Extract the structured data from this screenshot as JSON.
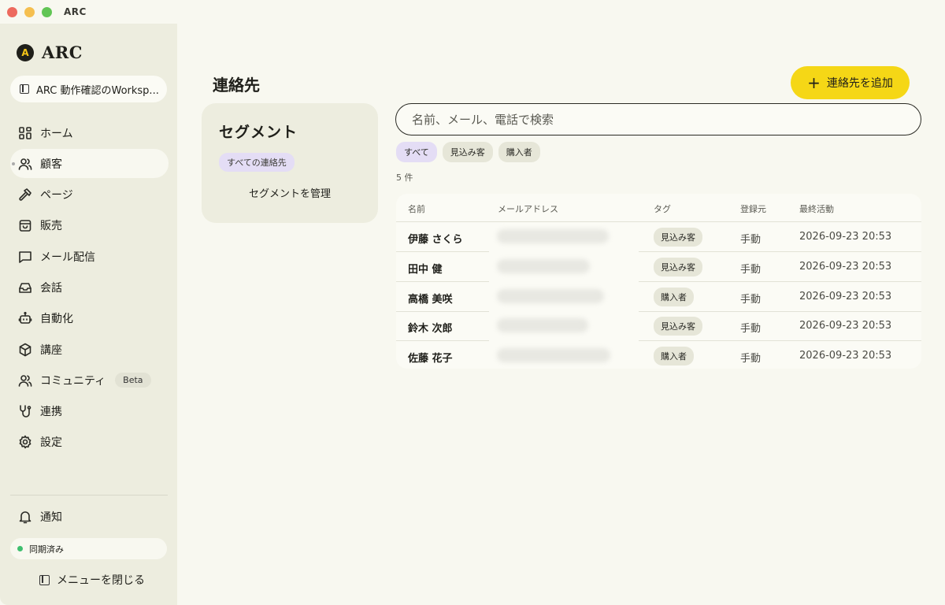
{
  "window": {
    "title": "ARC"
  },
  "brand": {
    "logo_letter": "A",
    "name": "ARC"
  },
  "workspace": {
    "label": "ARC 動作確認のWorksp..."
  },
  "sidebar": {
    "items": [
      {
        "label": "ホーム",
        "icon": "grid-icon"
      },
      {
        "label": "顧客",
        "icon": "users-icon",
        "active": true
      },
      {
        "label": "ページ",
        "icon": "hammer-icon"
      },
      {
        "label": "販売",
        "icon": "bag-icon"
      },
      {
        "label": "メール配信",
        "icon": "message-icon"
      },
      {
        "label": "会話",
        "icon": "inbox-icon"
      },
      {
        "label": "自動化",
        "icon": "robot-icon"
      },
      {
        "label": "講座",
        "icon": "cube-icon"
      },
      {
        "label": "コミュニティ",
        "icon": "community-icon",
        "badge": "Beta"
      },
      {
        "label": "連携",
        "icon": "plug-icon"
      },
      {
        "label": "設定",
        "icon": "gear-icon"
      }
    ],
    "notifications_label": "通知",
    "sync_status": "同期済み",
    "close_menu_label": "メニューを閉じる"
  },
  "main": {
    "title": "連絡先",
    "add_button_label": "連絡先を追加",
    "segment": {
      "title": "セグメント",
      "chip": "すべての連絡先",
      "manage_label": "セグメントを管理"
    },
    "search": {
      "placeholder": "名前、メール、電話で検索"
    },
    "filters": [
      "すべて",
      "見込み客",
      "購入者"
    ],
    "count": "5 件",
    "table": {
      "headers": [
        "名前",
        "メールアドレス",
        "タグ",
        "登録元",
        "最終活動"
      ],
      "rows": [
        {
          "name": "伊藤 さくら",
          "tag": "見込み客",
          "source": "手動",
          "activity": "2026-09-23 20:53"
        },
        {
          "name": "田中 健",
          "tag": "見込み客",
          "source": "手動",
          "activity": "2026-09-23 20:53"
        },
        {
          "name": "高橋 美咲",
          "tag": "購入者",
          "source": "手動",
          "activity": "2026-09-23 20:53"
        },
        {
          "name": "鈴木 次郎",
          "tag": "見込み客",
          "source": "手動",
          "activity": "2026-09-23 20:53"
        },
        {
          "name": "佐藤 花子",
          "tag": "購入者",
          "source": "手動",
          "activity": "2026-09-23 20:53"
        }
      ]
    }
  },
  "colors": {
    "accent_yellow": "#f5d716",
    "active_chip_lavender": "#e4ddf5",
    "sync_green": "#3fbf6f"
  }
}
